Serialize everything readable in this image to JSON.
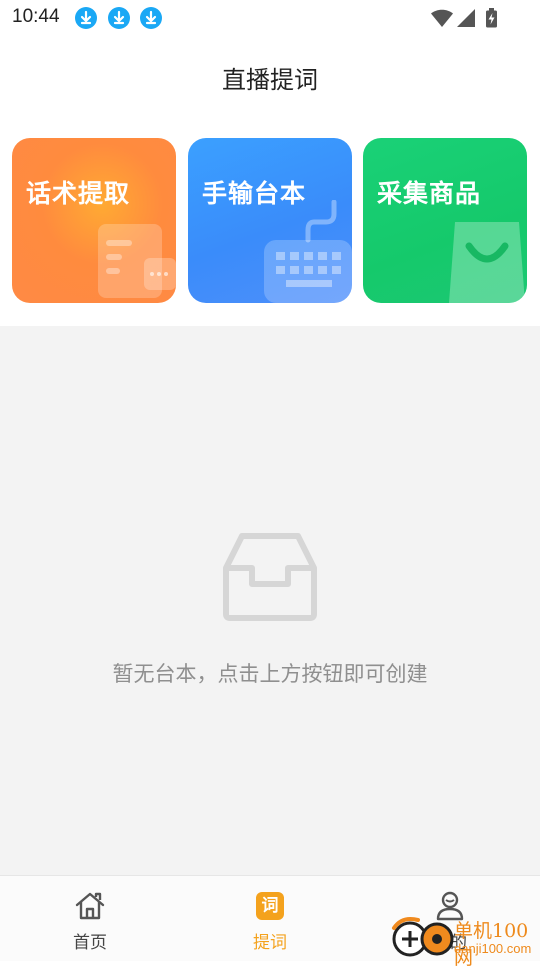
{
  "status_bar": {
    "time": "10:44",
    "notification_icons": [
      "download-icon",
      "download-icon",
      "download-icon"
    ],
    "system_icons": [
      "wifi-icon",
      "signal-icon",
      "battery-charging-icon"
    ]
  },
  "header": {
    "title": "直播提词"
  },
  "cards": [
    {
      "label": "话术提取",
      "icon": "document-icon",
      "color": "#ff8a3d"
    },
    {
      "label": "手输台本",
      "icon": "keyboard-icon",
      "color": "#3b8dfb"
    },
    {
      "label": "采集商品",
      "icon": "shopping-bag-icon",
      "color": "#18c96e"
    }
  ],
  "empty_state": {
    "icon": "empty-inbox-icon",
    "message": "暂无台本，点击上方按钮即可创建"
  },
  "tabbar": {
    "tabs": [
      {
        "label": "首页",
        "icon": "home-icon",
        "active": false
      },
      {
        "label": "提词",
        "icon": "word-icon",
        "icon_text": "词",
        "active": true
      },
      {
        "label": "我的",
        "icon": "profile-icon",
        "active": false
      }
    ],
    "active_color": "#f4a21d"
  },
  "watermark": {
    "title": "单机100网",
    "url": "danji100.com"
  }
}
